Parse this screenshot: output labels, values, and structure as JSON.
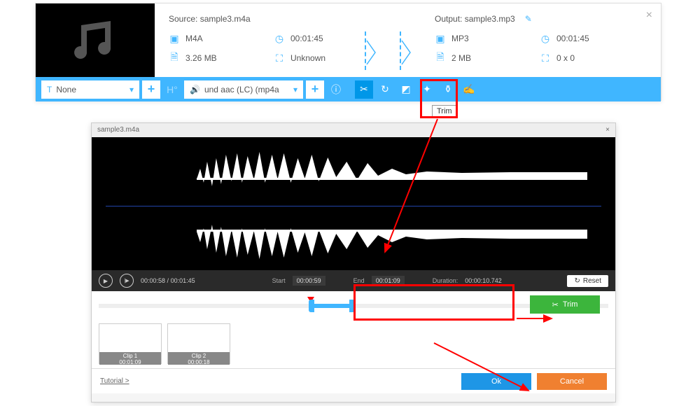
{
  "header": {
    "source_label": "Source: sample3.m4a",
    "output_label": "Output: sample3.mp3",
    "src": {
      "format": "M4A",
      "duration": "00:01:45",
      "size": "3.26 MB",
      "res": "Unknown"
    },
    "out": {
      "format": "MP3",
      "duration": "00:01:45",
      "size": "2 MB",
      "res": "0 x 0"
    }
  },
  "toolbar": {
    "subtitle": "None",
    "audio": "und aac (LC) (mp4a",
    "trim_tooltip": "Trim"
  },
  "editor": {
    "title": "sample3.m4a",
    "pos": "00:00:58",
    "total": "00:01:45",
    "start_label": "Start",
    "start": "00:00:59",
    "end_label": "End",
    "end": "00:01:09",
    "dur_label": "Duration:",
    "dur": "00:00:10.742",
    "reset": "Reset",
    "trim": "Trim",
    "clips": [
      {
        "name": "Clip 1",
        "time": "00:01:09"
      },
      {
        "name": "Clip 2",
        "time": "00:00:18"
      }
    ],
    "tutorial": "Tutorial >",
    "ok": "Ok",
    "cancel": "Cancel"
  }
}
